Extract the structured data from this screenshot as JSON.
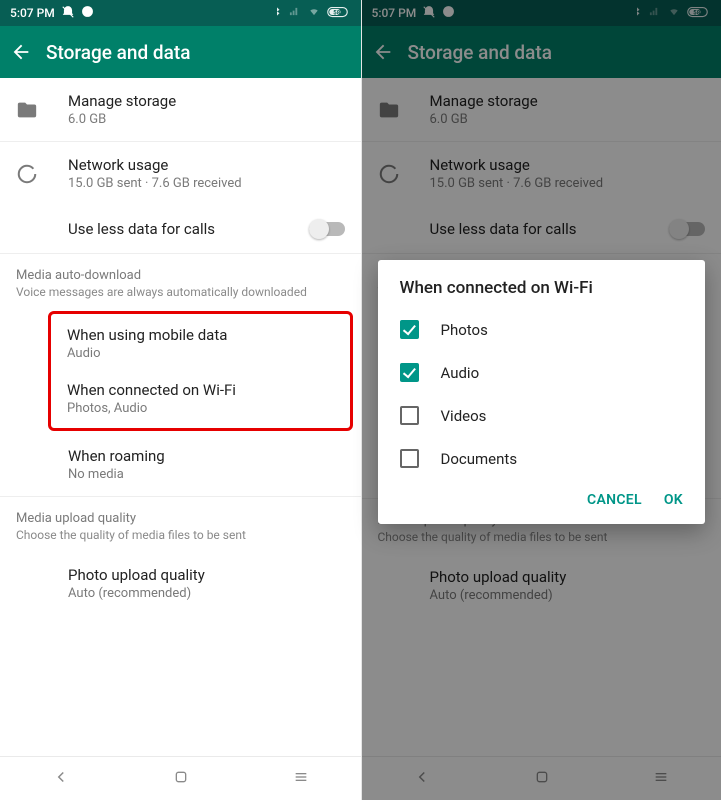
{
  "status": {
    "time": "5:07 PM"
  },
  "header": {
    "title": "Storage and data"
  },
  "manage_storage": {
    "label": "Manage storage",
    "sub": "6.0 GB"
  },
  "network_usage": {
    "label": "Network usage",
    "sub": "15.0 GB sent · 7.6 GB received"
  },
  "use_less_data": {
    "label": "Use less data for calls",
    "enabled": false
  },
  "media_auto_download": {
    "section": "Media auto-download",
    "hint": "Voice messages are always automatically downloaded",
    "mobile": {
      "label": "When using mobile data",
      "sub": "Audio"
    },
    "wifi": {
      "label": "When connected on Wi-Fi",
      "sub": "Photos, Audio"
    },
    "roaming": {
      "label": "When roaming",
      "sub": "No media"
    }
  },
  "media_upload_quality": {
    "section": "Media upload quality",
    "hint": "Choose the quality of media files to be sent",
    "photo": {
      "label": "Photo upload quality",
      "sub": "Auto (recommended)"
    }
  },
  "dialog": {
    "title": "When connected on Wi-Fi",
    "options": [
      {
        "label": "Photos",
        "checked": true
      },
      {
        "label": "Audio",
        "checked": true
      },
      {
        "label": "Videos",
        "checked": false
      },
      {
        "label": "Documents",
        "checked": false
      }
    ],
    "cancel": "CANCEL",
    "ok": "OK"
  },
  "colors": {
    "teal_dark": "#075E54",
    "teal": "#008069",
    "accent": "#009688",
    "highlight": "#e60000"
  }
}
